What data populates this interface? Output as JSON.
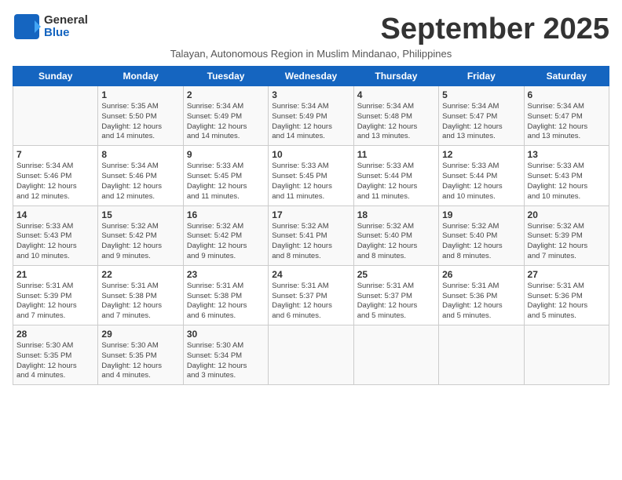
{
  "logo": {
    "line1": "General",
    "line2": "Blue"
  },
  "title": "September 2025",
  "location": "Talayan, Autonomous Region in Muslim Mindanao, Philippines",
  "weekdays": [
    "Sunday",
    "Monday",
    "Tuesday",
    "Wednesday",
    "Thursday",
    "Friday",
    "Saturday"
  ],
  "weeks": [
    [
      {
        "date": "",
        "info": ""
      },
      {
        "date": "1",
        "info": "Sunrise: 5:35 AM\nSunset: 5:50 PM\nDaylight: 12 hours\nand 14 minutes."
      },
      {
        "date": "2",
        "info": "Sunrise: 5:34 AM\nSunset: 5:49 PM\nDaylight: 12 hours\nand 14 minutes."
      },
      {
        "date": "3",
        "info": "Sunrise: 5:34 AM\nSunset: 5:49 PM\nDaylight: 12 hours\nand 14 minutes."
      },
      {
        "date": "4",
        "info": "Sunrise: 5:34 AM\nSunset: 5:48 PM\nDaylight: 12 hours\nand 13 minutes."
      },
      {
        "date": "5",
        "info": "Sunrise: 5:34 AM\nSunset: 5:47 PM\nDaylight: 12 hours\nand 13 minutes."
      },
      {
        "date": "6",
        "info": "Sunrise: 5:34 AM\nSunset: 5:47 PM\nDaylight: 12 hours\nand 13 minutes."
      }
    ],
    [
      {
        "date": "7",
        "info": "Sunrise: 5:34 AM\nSunset: 5:46 PM\nDaylight: 12 hours\nand 12 minutes."
      },
      {
        "date": "8",
        "info": "Sunrise: 5:34 AM\nSunset: 5:46 PM\nDaylight: 12 hours\nand 12 minutes."
      },
      {
        "date": "9",
        "info": "Sunrise: 5:33 AM\nSunset: 5:45 PM\nDaylight: 12 hours\nand 11 minutes."
      },
      {
        "date": "10",
        "info": "Sunrise: 5:33 AM\nSunset: 5:45 PM\nDaylight: 12 hours\nand 11 minutes."
      },
      {
        "date": "11",
        "info": "Sunrise: 5:33 AM\nSunset: 5:44 PM\nDaylight: 12 hours\nand 11 minutes."
      },
      {
        "date": "12",
        "info": "Sunrise: 5:33 AM\nSunset: 5:44 PM\nDaylight: 12 hours\nand 10 minutes."
      },
      {
        "date": "13",
        "info": "Sunrise: 5:33 AM\nSunset: 5:43 PM\nDaylight: 12 hours\nand 10 minutes."
      }
    ],
    [
      {
        "date": "14",
        "info": "Sunrise: 5:33 AM\nSunset: 5:43 PM\nDaylight: 12 hours\nand 10 minutes."
      },
      {
        "date": "15",
        "info": "Sunrise: 5:32 AM\nSunset: 5:42 PM\nDaylight: 12 hours\nand 9 minutes."
      },
      {
        "date": "16",
        "info": "Sunrise: 5:32 AM\nSunset: 5:42 PM\nDaylight: 12 hours\nand 9 minutes."
      },
      {
        "date": "17",
        "info": "Sunrise: 5:32 AM\nSunset: 5:41 PM\nDaylight: 12 hours\nand 8 minutes."
      },
      {
        "date": "18",
        "info": "Sunrise: 5:32 AM\nSunset: 5:40 PM\nDaylight: 12 hours\nand 8 minutes."
      },
      {
        "date": "19",
        "info": "Sunrise: 5:32 AM\nSunset: 5:40 PM\nDaylight: 12 hours\nand 8 minutes."
      },
      {
        "date": "20",
        "info": "Sunrise: 5:32 AM\nSunset: 5:39 PM\nDaylight: 12 hours\nand 7 minutes."
      }
    ],
    [
      {
        "date": "21",
        "info": "Sunrise: 5:31 AM\nSunset: 5:39 PM\nDaylight: 12 hours\nand 7 minutes."
      },
      {
        "date": "22",
        "info": "Sunrise: 5:31 AM\nSunset: 5:38 PM\nDaylight: 12 hours\nand 7 minutes."
      },
      {
        "date": "23",
        "info": "Sunrise: 5:31 AM\nSunset: 5:38 PM\nDaylight: 12 hours\nand 6 minutes."
      },
      {
        "date": "24",
        "info": "Sunrise: 5:31 AM\nSunset: 5:37 PM\nDaylight: 12 hours\nand 6 minutes."
      },
      {
        "date": "25",
        "info": "Sunrise: 5:31 AM\nSunset: 5:37 PM\nDaylight: 12 hours\nand 5 minutes."
      },
      {
        "date": "26",
        "info": "Sunrise: 5:31 AM\nSunset: 5:36 PM\nDaylight: 12 hours\nand 5 minutes."
      },
      {
        "date": "27",
        "info": "Sunrise: 5:31 AM\nSunset: 5:36 PM\nDaylight: 12 hours\nand 5 minutes."
      }
    ],
    [
      {
        "date": "28",
        "info": "Sunrise: 5:30 AM\nSunset: 5:35 PM\nDaylight: 12 hours\nand 4 minutes."
      },
      {
        "date": "29",
        "info": "Sunrise: 5:30 AM\nSunset: 5:35 PM\nDaylight: 12 hours\nand 4 minutes."
      },
      {
        "date": "30",
        "info": "Sunrise: 5:30 AM\nSunset: 5:34 PM\nDaylight: 12 hours\nand 3 minutes."
      },
      {
        "date": "",
        "info": ""
      },
      {
        "date": "",
        "info": ""
      },
      {
        "date": "",
        "info": ""
      },
      {
        "date": "",
        "info": ""
      }
    ]
  ]
}
